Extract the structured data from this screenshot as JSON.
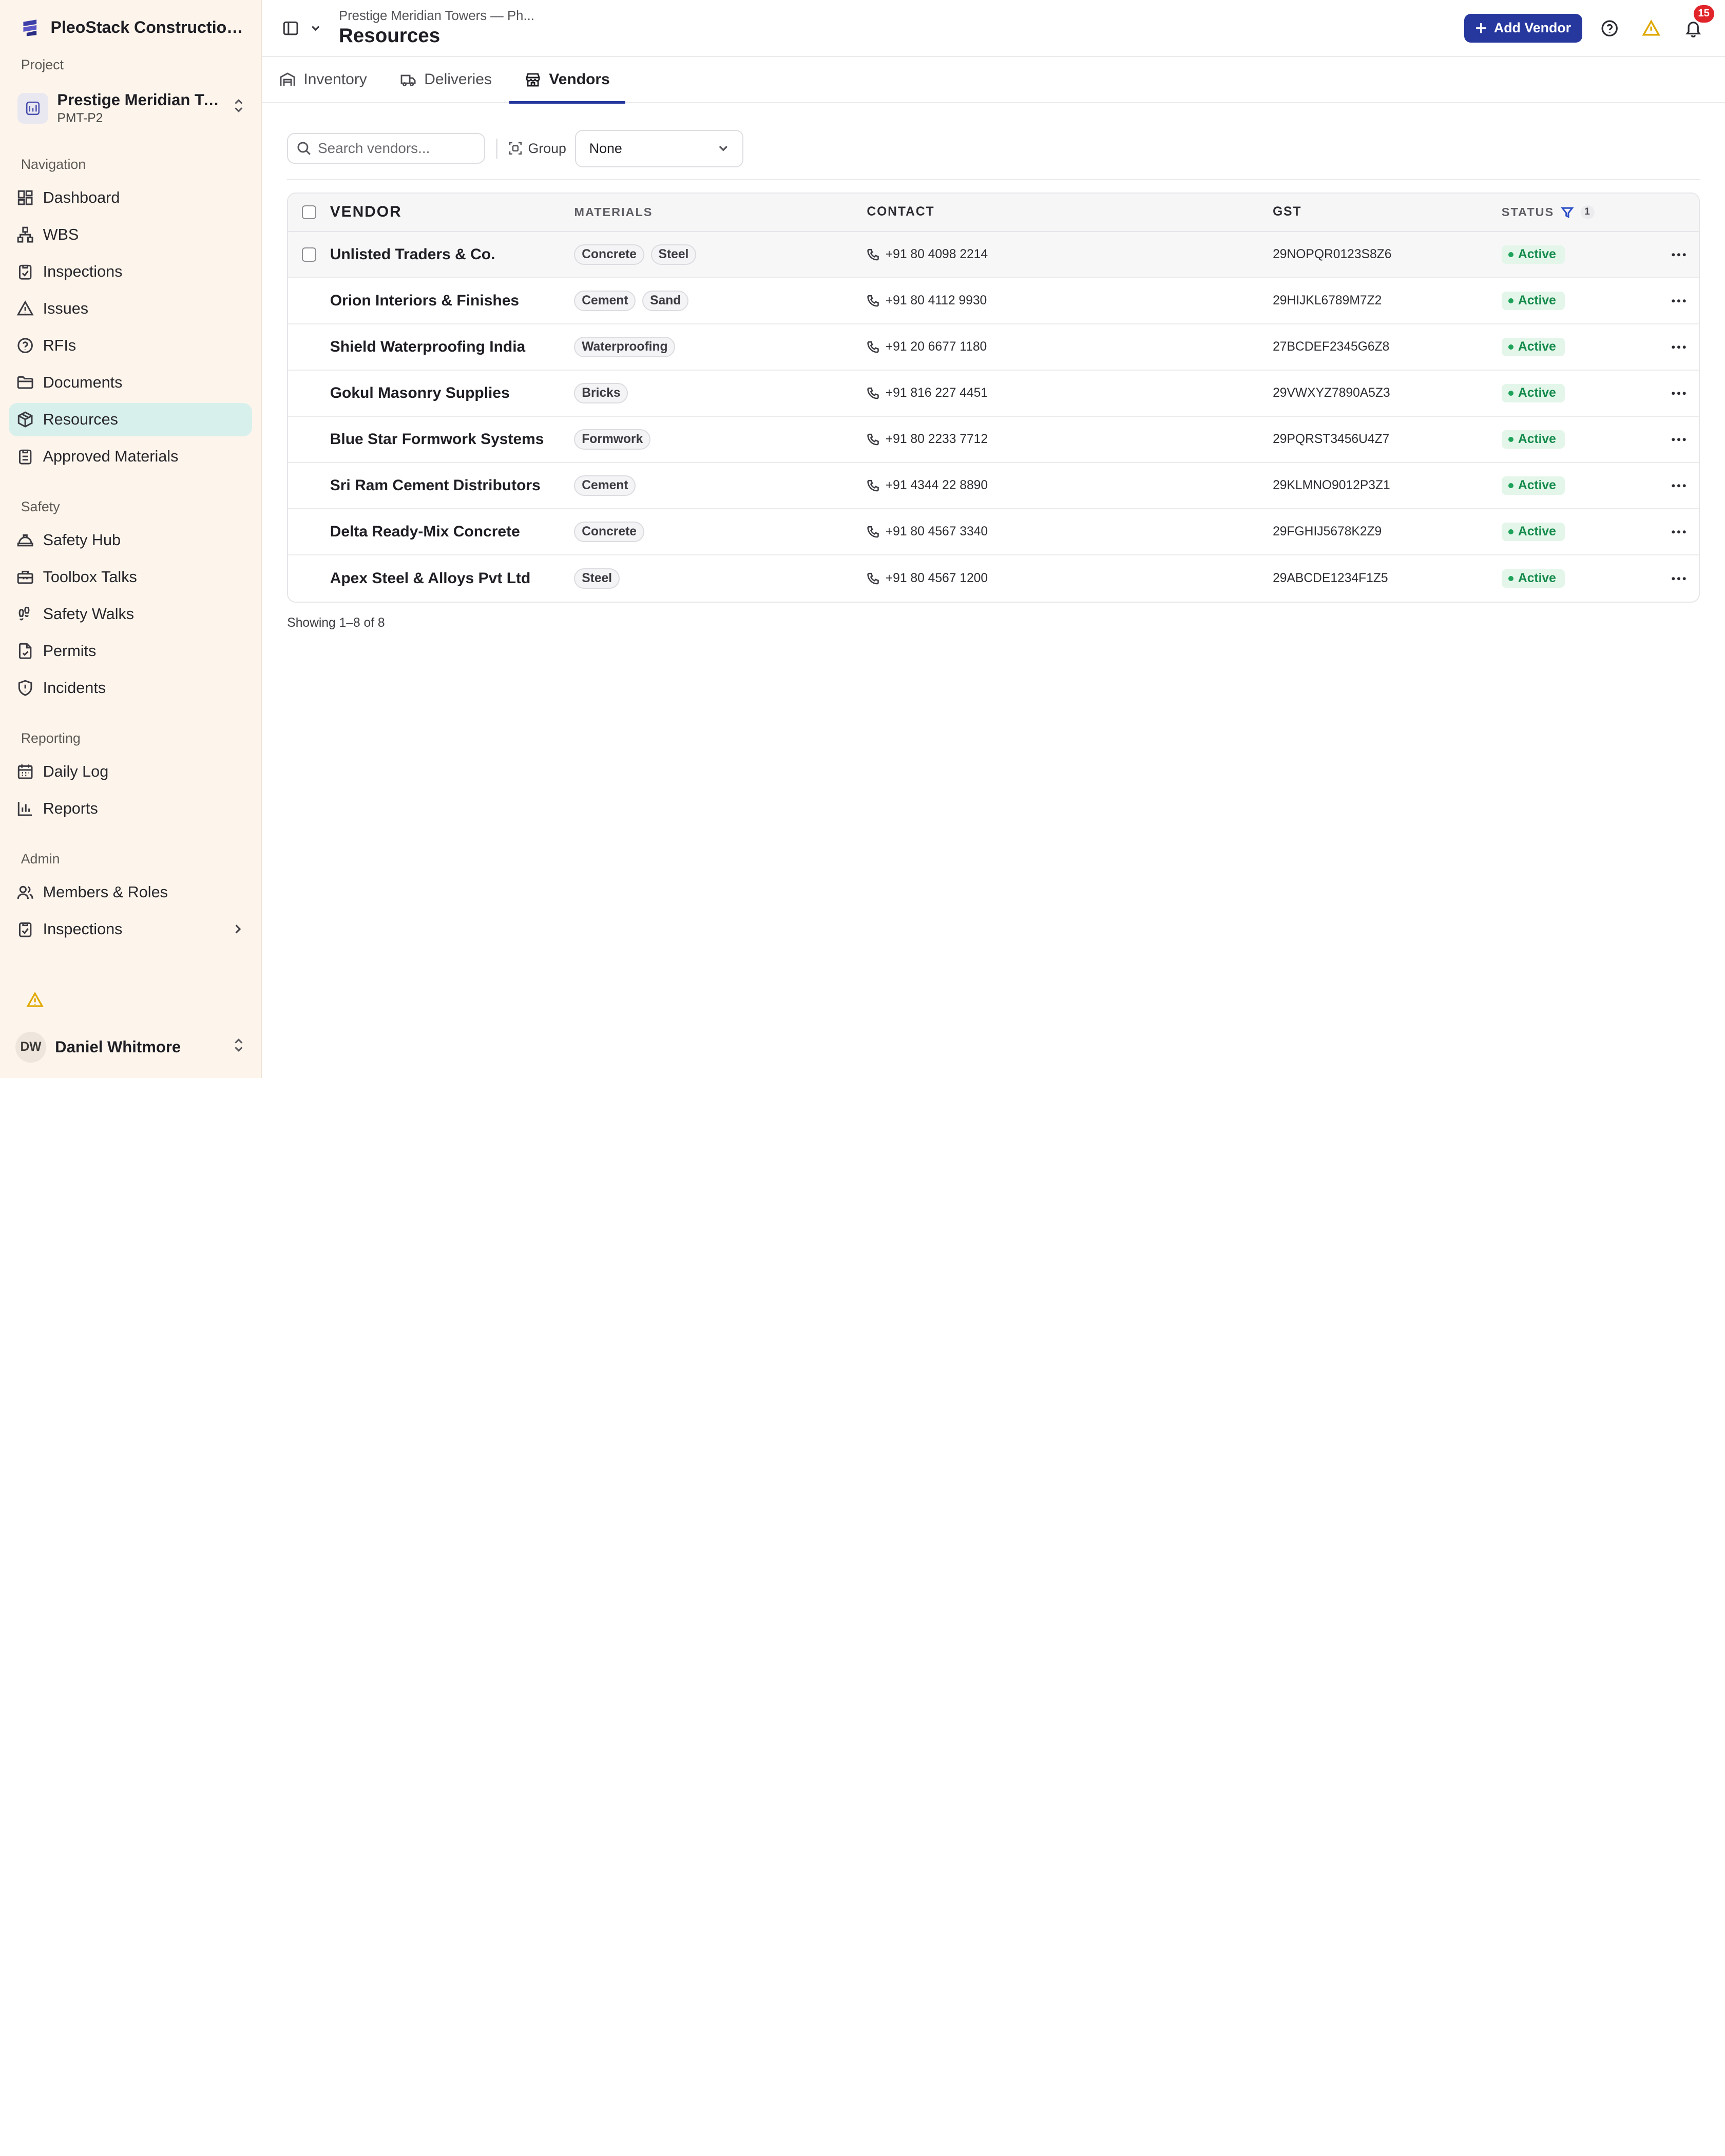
{
  "brand": {
    "name": "PleoStack Construction ...",
    "logo_icon": "stack-layers-icon"
  },
  "project": {
    "section_label": "Project",
    "name": "Prestige Meridian To...",
    "code": "PMT-P2"
  },
  "sidebar": {
    "groups": [
      {
        "label": "Navigation",
        "items": [
          {
            "label": "Dashboard",
            "icon": "dashboard-icon"
          },
          {
            "label": "WBS",
            "icon": "hierarchy-icon"
          },
          {
            "label": "Inspections",
            "icon": "clipboard-check-icon"
          },
          {
            "label": "Issues",
            "icon": "warning-triangle-icon"
          },
          {
            "label": "RFIs",
            "icon": "help-circle-icon"
          },
          {
            "label": "Documents",
            "icon": "folder-icon"
          },
          {
            "label": "Resources",
            "icon": "package-icon",
            "active": true
          },
          {
            "label": "Approved Materials",
            "icon": "clipboard-list-icon"
          }
        ]
      },
      {
        "label": "Safety",
        "items": [
          {
            "label": "Safety Hub",
            "icon": "hard-hat-icon"
          },
          {
            "label": "Toolbox Talks",
            "icon": "toolbox-icon"
          },
          {
            "label": "Safety Walks",
            "icon": "footprints-icon"
          },
          {
            "label": "Permits",
            "icon": "file-check-icon"
          },
          {
            "label": "Incidents",
            "icon": "shield-alert-icon"
          }
        ]
      },
      {
        "label": "Reporting",
        "items": [
          {
            "label": "Daily Log",
            "icon": "calendar-icon"
          },
          {
            "label": "Reports",
            "icon": "bar-chart-icon"
          }
        ]
      },
      {
        "label": "Admin",
        "items": [
          {
            "label": "Members & Roles",
            "icon": "users-icon"
          },
          {
            "label": "Inspections",
            "icon": "clipboard-check-icon",
            "has_submenu": true
          }
        ]
      }
    ]
  },
  "user": {
    "initials": "DW",
    "name": "Daniel Whitmore"
  },
  "header": {
    "breadcrumb": "Prestige Meridian Towers — Ph...",
    "title": "Resources",
    "add_button": "Add Vendor",
    "notification_count": "15"
  },
  "tabs": [
    {
      "label": "Inventory",
      "icon": "warehouse-icon"
    },
    {
      "label": "Deliveries",
      "icon": "truck-icon"
    },
    {
      "label": "Vendors",
      "icon": "store-icon",
      "active": true
    }
  ],
  "filters": {
    "search_placeholder": "Search vendors...",
    "group_label": "Group",
    "group_value": "None"
  },
  "table": {
    "columns": {
      "vendor": "Vendor",
      "materials": "Materials",
      "contact": "Contact",
      "gst": "GST",
      "status": "Status",
      "status_filter_count": "1"
    },
    "rows": [
      {
        "vendor": "Unlisted Traders & Co.",
        "materials": [
          "Concrete",
          "Steel"
        ],
        "phone": "+91 80 4098 2214",
        "gst": "29NOPQR0123S8Z6",
        "status": "Active"
      },
      {
        "vendor": "Orion Interiors & Finishes",
        "materials": [
          "Cement",
          "Sand"
        ],
        "phone": "+91 80 4112 9930",
        "gst": "29HIJKL6789M7Z2",
        "status": "Active"
      },
      {
        "vendor": "Shield Waterproofing India",
        "materials": [
          "Waterproofing"
        ],
        "phone": "+91 20 6677 1180",
        "gst": "27BCDEF2345G6Z8",
        "status": "Active"
      },
      {
        "vendor": "Gokul Masonry Supplies",
        "materials": [
          "Bricks"
        ],
        "phone": "+91 816 227 4451",
        "gst": "29VWXYZ7890A5Z3",
        "status": "Active"
      },
      {
        "vendor": "Blue Star Formwork Systems",
        "materials": [
          "Formwork"
        ],
        "phone": "+91 80 2233 7712",
        "gst": "29PQRST3456U4Z7",
        "status": "Active"
      },
      {
        "vendor": "Sri Ram Cement Distributors",
        "materials": [
          "Cement"
        ],
        "phone": "+91 4344 22 8890",
        "gst": "29KLMNO9012P3Z1",
        "status": "Active"
      },
      {
        "vendor": "Delta Ready-Mix Concrete",
        "materials": [
          "Concrete"
        ],
        "phone": "+91 80 4567 3340",
        "gst": "29FGHIJ5678K2Z9",
        "status": "Active"
      },
      {
        "vendor": "Apex Steel & Alloys Pvt Ltd",
        "materials": [
          "Steel"
        ],
        "phone": "+91 80 4567 1200",
        "gst": "29ABCDE1234F1Z5",
        "status": "Active"
      }
    ],
    "footer": "Showing 1–8 of 8"
  },
  "colors": {
    "accent": "#26389e",
    "sidebar_bg": "#fdf5ec",
    "active_nav_bg": "#d8f0ec",
    "status_green": "#148a4b",
    "warning": "#e0a800",
    "badge_red": "#e0242a"
  }
}
